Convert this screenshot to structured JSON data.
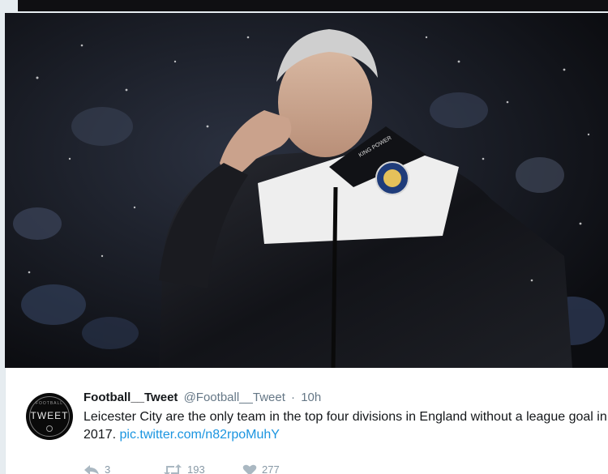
{
  "tweet": {
    "display_name": "Football__Tweet",
    "handle": "@Football__Tweet",
    "separator": "·",
    "time": "10h",
    "text_main": "Leicester City are the only team in the top four divisions in England without a league goal in 2017.",
    "link": "pic.twitter.com/n82rpoMuhY",
    "avatar_text": "TWEET",
    "avatar_small_text": "FOOTBALL"
  },
  "actions": {
    "reply_count": "3",
    "retweet_count": "193",
    "like_count": "277"
  },
  "photo": {
    "crest_text": "KING POWER"
  },
  "colors": {
    "link": "#1b95e0",
    "name": "#14171a",
    "meta": "#657786",
    "background": "#e6ecf0"
  }
}
